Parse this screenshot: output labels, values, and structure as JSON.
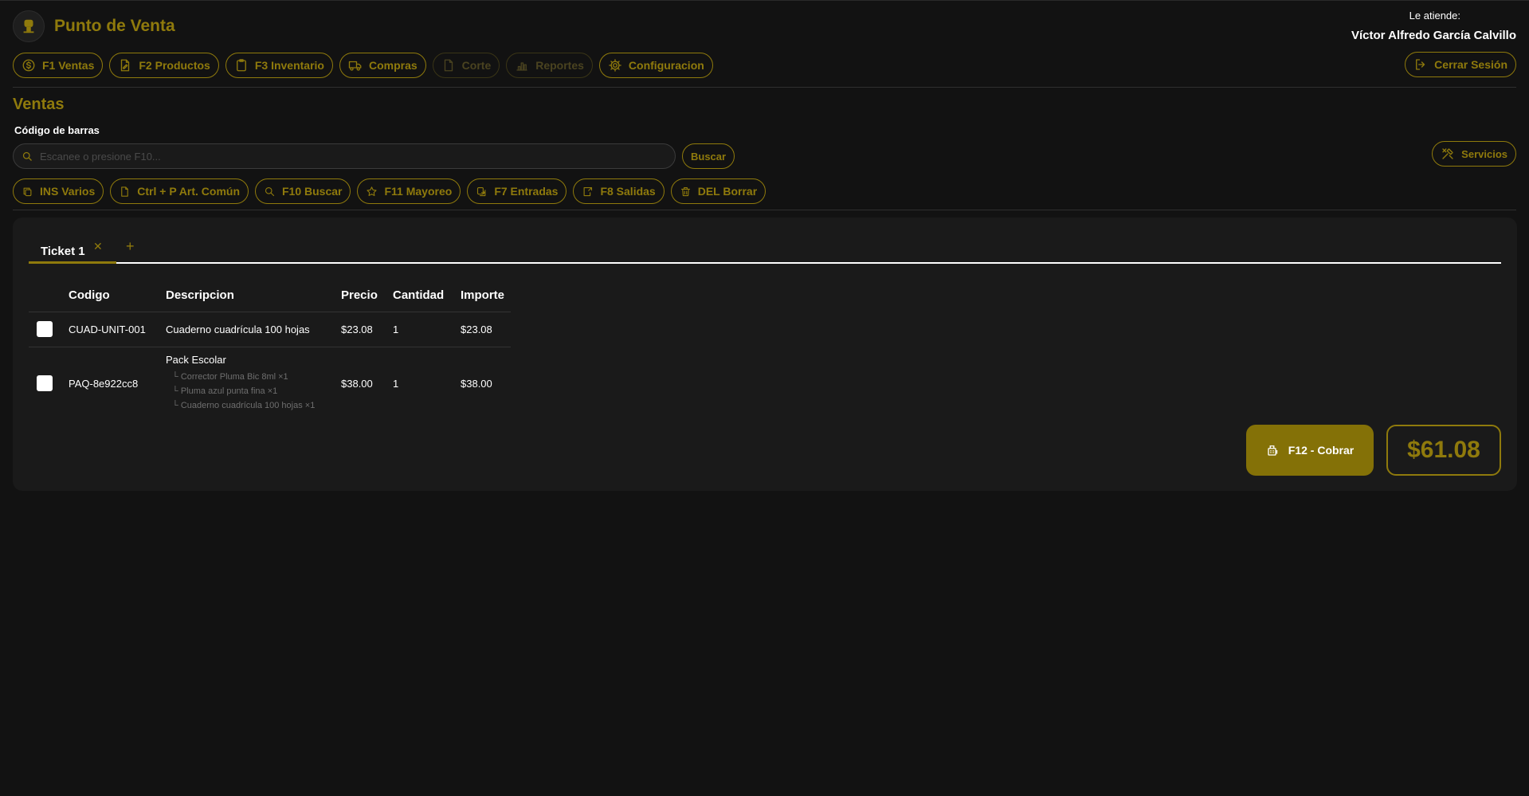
{
  "app": {
    "title": "Punto de Venta"
  },
  "user": {
    "label": "Le atiende:",
    "name": "Víctor Alfredo García Calvillo"
  },
  "nav": [
    {
      "label": "F1 Ventas",
      "icon": "dollar-icon",
      "disabled": false
    },
    {
      "label": "F2 Productos",
      "icon": "document-edit-icon",
      "disabled": false
    },
    {
      "label": "F3 Inventario",
      "icon": "clipboard-icon",
      "disabled": false
    },
    {
      "label": "Compras",
      "icon": "truck-icon",
      "disabled": false
    },
    {
      "label": "Corte",
      "icon": "file-icon",
      "disabled": true
    },
    {
      "label": "Reportes",
      "icon": "bar-chart-icon",
      "disabled": true
    },
    {
      "label": "Configuracion",
      "icon": "gear-icon",
      "disabled": false
    }
  ],
  "logout": {
    "label": "Cerrar Sesión"
  },
  "page": {
    "title": "Ventas"
  },
  "search": {
    "label": "Código de barras",
    "placeholder": "Escanee o presione F10...",
    "button": "Buscar"
  },
  "servicios": {
    "label": "Servicios"
  },
  "actions": [
    {
      "label": "INS Varios",
      "icon": "copy-icon"
    },
    {
      "label": "Ctrl + P Art. Común",
      "icon": "file-icon"
    },
    {
      "label": "F10 Buscar",
      "icon": "search-icon"
    },
    {
      "label": "F11 Mayoreo",
      "icon": "star-icon"
    },
    {
      "label": "F7 Entradas",
      "icon": "entry-icon"
    },
    {
      "label": "F8 Salidas",
      "icon": "exit-icon"
    },
    {
      "label": "DEL Borrar",
      "icon": "trash-icon"
    }
  ],
  "tabs": [
    {
      "label": "Ticket 1",
      "close": "✕"
    }
  ],
  "tab_add": "+",
  "table": {
    "headers": [
      "Codigo",
      "Descripcion",
      "Precio",
      "Cantidad",
      "Importe"
    ],
    "rows": [
      {
        "code": "CUAD-UNIT-001",
        "description": "Cuaderno cuadrícula 100 hojas",
        "price": "$23.08",
        "qty": "1",
        "amount": "$23.08",
        "components": []
      },
      {
        "code": "PAQ-8e922cc8",
        "description": "Pack Escolar",
        "price": "$38.00",
        "qty": "1",
        "amount": "$38.00",
        "components": [
          "└ Corrector Pluma Bic 8ml ×1",
          "└ Pluma azul punta fina ×1",
          "└ Cuaderno cuadrícula 100 hojas ×1"
        ]
      }
    ]
  },
  "checkout": {
    "label": "F12 - Cobrar",
    "total": "$61.08"
  },
  "colors": {
    "accent": "#8f7a0c",
    "background": "#121212",
    "panel": "#1a1a1a",
    "button": "#847107"
  }
}
